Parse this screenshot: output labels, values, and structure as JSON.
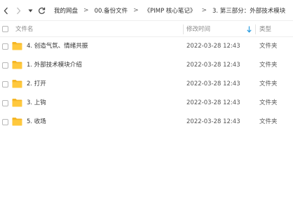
{
  "breadcrumbs": [
    "我的网盘",
    "00.备份文件",
    "《PIMP 核心笔记》",
    "3. 第三部分：外部技术模块"
  ],
  "columns": {
    "name": "文件名",
    "time": "修改时间",
    "type": "类型"
  },
  "rows": [
    {
      "name": "4. 创造气氛、情绪共振",
      "time": "2022-03-28 12:43",
      "type": "文件夹"
    },
    {
      "name": "1. 外部技术模块介绍",
      "time": "2022-03-28 12:43",
      "type": "文件夹"
    },
    {
      "name": "2. 打开",
      "time": "2022-03-28 12:43",
      "type": "文件夹"
    },
    {
      "name": "3. 上钩",
      "time": "2022-03-28 12:43",
      "type": "文件夹"
    },
    {
      "name": "5. 收场",
      "time": "2022-03-28 12:43",
      "type": "文件夹"
    }
  ],
  "colors": {
    "folder": "#FFC83D",
    "folder_dark": "#F5B625",
    "sort_arrow": "#2B9CE0"
  }
}
